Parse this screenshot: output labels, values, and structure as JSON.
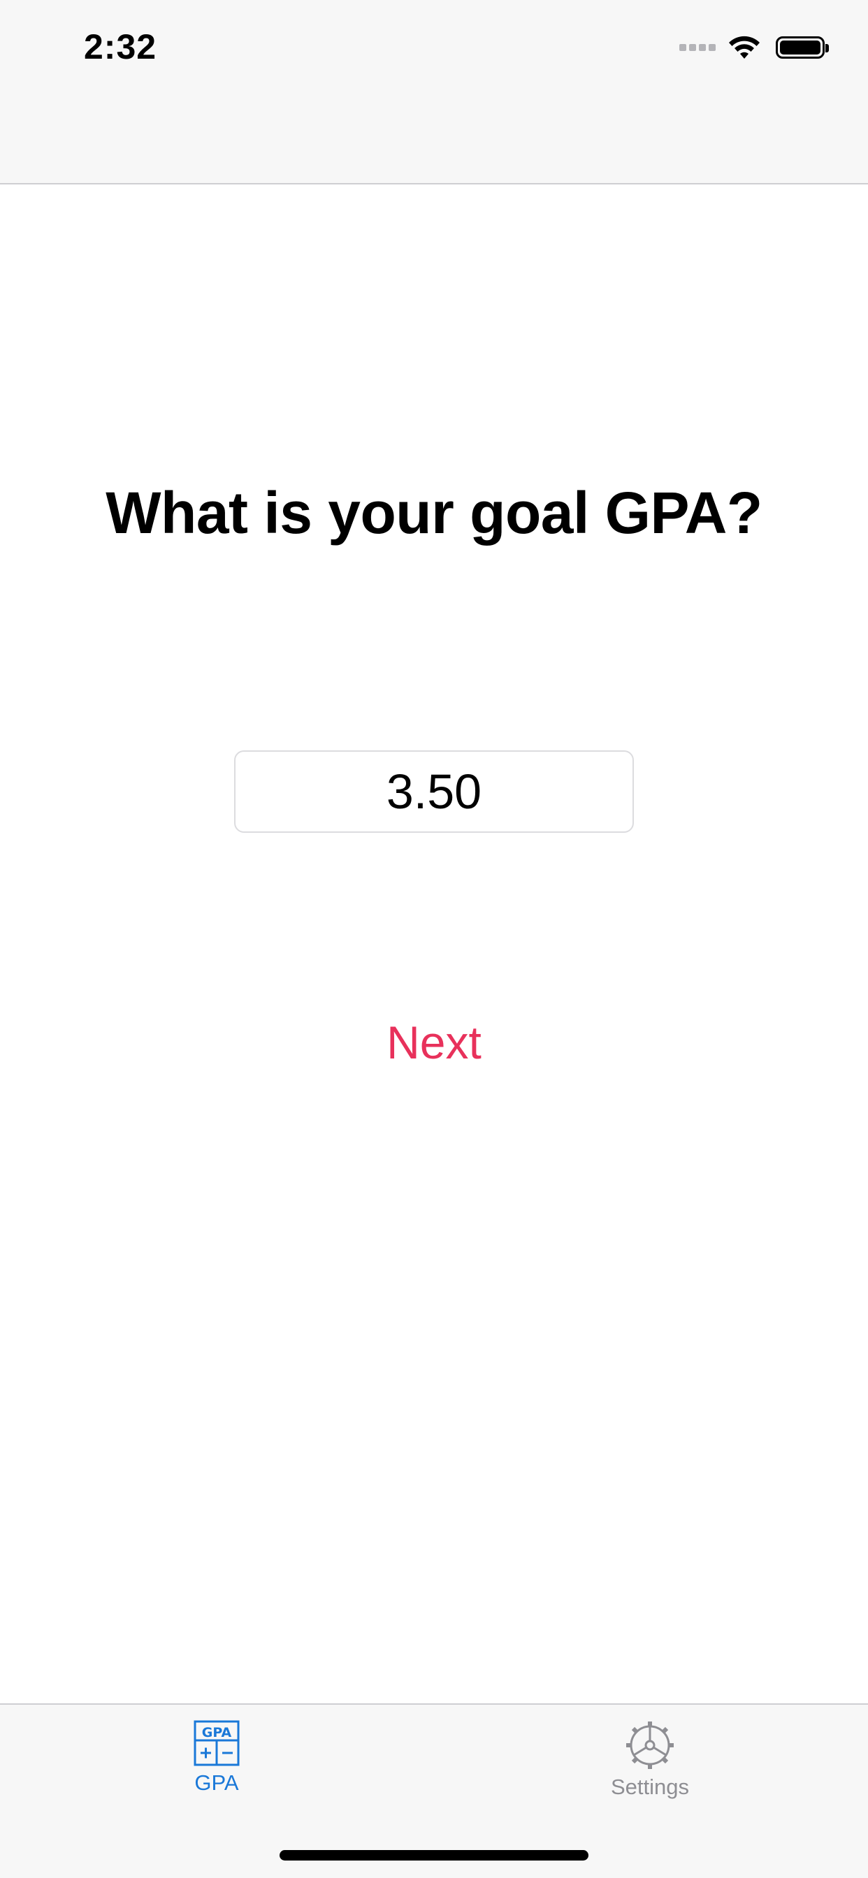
{
  "status_bar": {
    "time": "2:32"
  },
  "main": {
    "question": "What is your goal GPA?",
    "gpa_value": "3.50",
    "next_label": "Next"
  },
  "tab_bar": {
    "tabs": [
      {
        "label": "GPA",
        "icon": "gpa-calculator-icon",
        "selected": true
      },
      {
        "label": "Settings",
        "icon": "gear-icon",
        "selected": false
      }
    ]
  },
  "colors": {
    "accent_next": "#e8315b",
    "tab_selected": "#1a78d8",
    "tab_unselected": "#8e8e93"
  }
}
